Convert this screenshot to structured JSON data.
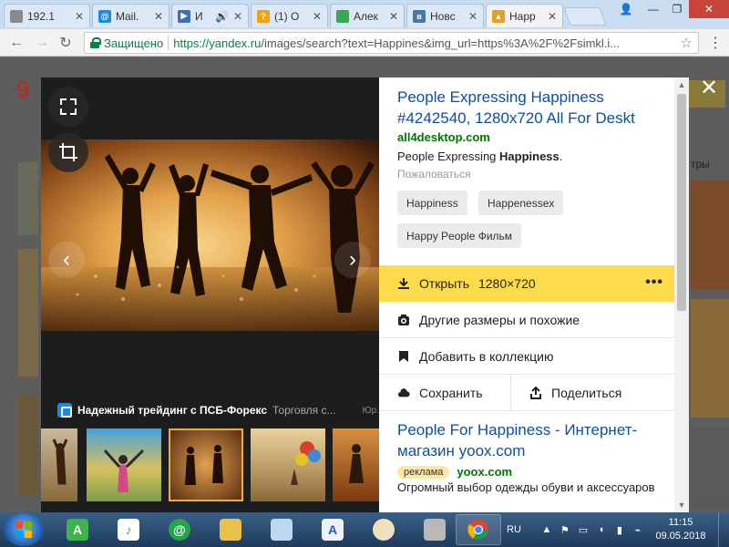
{
  "browser": {
    "tabs": [
      {
        "title": "192.1",
        "icon": "page-icon",
        "color": "#8a8a8a"
      },
      {
        "title": "Mail.",
        "icon": "at-icon",
        "color": "#168de2"
      },
      {
        "title": "И",
        "icon": "video-icon",
        "color": "#3b6fb6"
      },
      {
        "title": "(1) О",
        "icon": "question-icon",
        "color": "#f0a30a"
      },
      {
        "title": "Алек",
        "icon": "sheet-icon",
        "color": "#3aa757"
      },
      {
        "title": "Новс",
        "icon": "vk-icon",
        "color": "#4a76a8"
      },
      {
        "title": "Happ",
        "icon": "image-icon",
        "color": "#e0a020"
      }
    ],
    "secure_label": "Защищено",
    "url_host": "https://yandex.ru",
    "url_rest": "/images/search?text=Happines&img_url=https%3A%2F%2Fsimkl.i..."
  },
  "background": {
    "logo": "9",
    "side_text": "тры"
  },
  "viewer": {
    "ad_title": "Надежный трейдинг с ПСБ-Форекс",
    "ad_text": "Торговля с...",
    "ad_legal": "Юр."
  },
  "sidebar": {
    "title": "People Expressing Happiness #4242540, 1280x720 All For Deskt",
    "domain": "all4desktop.com",
    "desc_plain": "People Expressing ",
    "desc_bold": "Happiness",
    "desc_end": ".",
    "complain": "Пожаловаться",
    "tags": [
      "Happiness",
      "Happenessex",
      "Happy People Фильм"
    ],
    "open_label": "Открыть",
    "open_size": "1280×720",
    "more_label": "•••",
    "similar_label": "Другие размеры и похожие",
    "collection_label": "Добавить в коллекцию",
    "save_label": "Сохранить",
    "share_label": "Поделиться",
    "result2_title": "People For Happiness - Интернет-магазин yoox.com",
    "result2_badge": "реклама",
    "result2_domain": "yoox.com",
    "result2_desc": "Огромный выбор одежды обуви и аксессуаров"
  },
  "taskbar": {
    "language": "RU",
    "time": "11:15",
    "date": "09.05.2018"
  },
  "colors": {
    "link": "#0c4fa5",
    "domain": "#007700",
    "open_button": "#fedb4b"
  }
}
